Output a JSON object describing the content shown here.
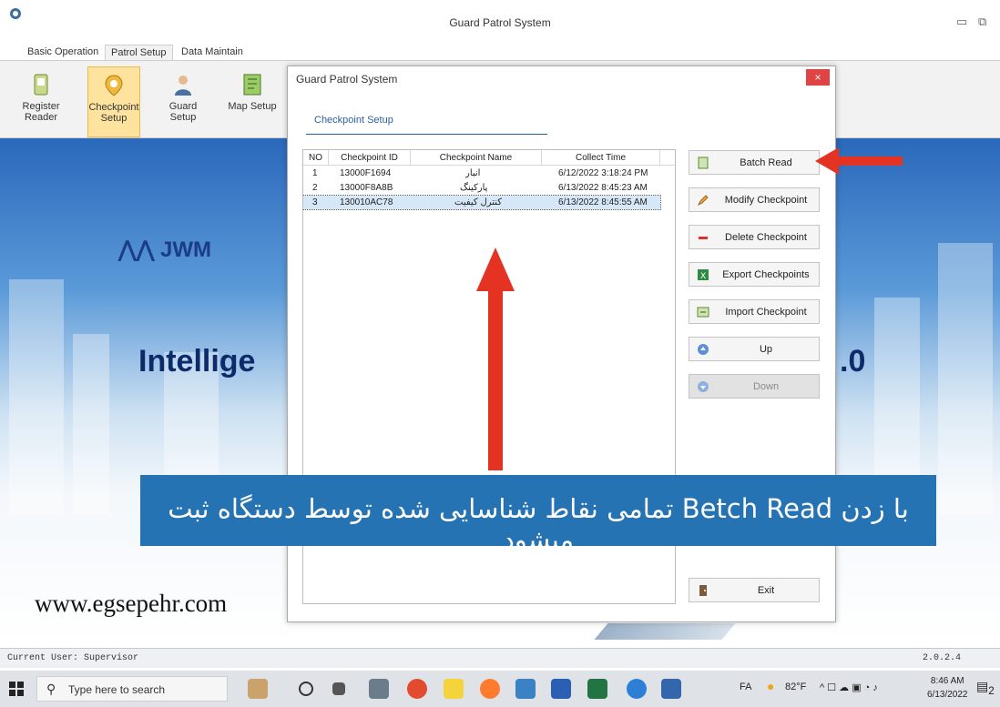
{
  "window": {
    "title": "Guard Patrol System"
  },
  "ribbon": {
    "tabs": [
      "Basic Operation",
      "Patrol Setup",
      "Data Maintain"
    ],
    "buttons": [
      {
        "label": "Register Reader",
        "icon": "register-reader-icon"
      },
      {
        "label": "Checkpoint Setup",
        "icon": "checkpoint-pin-icon"
      },
      {
        "label": "Guard Setup",
        "icon": "guard-person-icon"
      },
      {
        "label": "Map Setup",
        "icon": "map-icon"
      }
    ]
  },
  "background": {
    "logo": "JWM",
    "headline": "Intellige",
    "version_fragment": ".0",
    "website": "www.egsepehr.com"
  },
  "dialog": {
    "title": "Guard Patrol System",
    "close": "×",
    "section": "Checkpoint Setup",
    "columns": [
      "NO",
      "Checkpoint ID",
      "Checkpoint Name",
      "Collect Time"
    ],
    "rows": [
      {
        "no": "1",
        "id": "13000F1694",
        "name": "انبار",
        "time": "6/12/2022 3:18:24 PM"
      },
      {
        "no": "2",
        "id": "13000F8A8B",
        "name": "پارکینگ",
        "time": "6/13/2022 8:45:23 AM"
      },
      {
        "no": "3",
        "id": "130010AC78",
        "name": "کنترل کیفیت",
        "time": "6/13/2022 8:45:55 AM"
      }
    ],
    "buttons": {
      "batch_read": "Batch Read",
      "modify": "Modify Checkpoint",
      "delete": "Delete Checkpoint",
      "export": "Export Checkpoints",
      "import": "Import Checkpoint",
      "up": "Up",
      "down": "Down",
      "exit": "Exit"
    }
  },
  "overlay": {
    "banner_text": "با زدن Betch Read تمامی نقاط شناسایی شده توسط دستگاه ثبت میشود",
    "arrow_color": "#e53323",
    "banner_color": "#2673b4"
  },
  "statusbar": {
    "user": "Current User:  Supervisor",
    "version": "2.0.2.4"
  },
  "taskbar": {
    "search_placeholder": "Type here to search",
    "lang": "FA",
    "temperature": "82°F",
    "time": "8:46 AM",
    "date": "6/13/2022",
    "notification_count": "2"
  }
}
